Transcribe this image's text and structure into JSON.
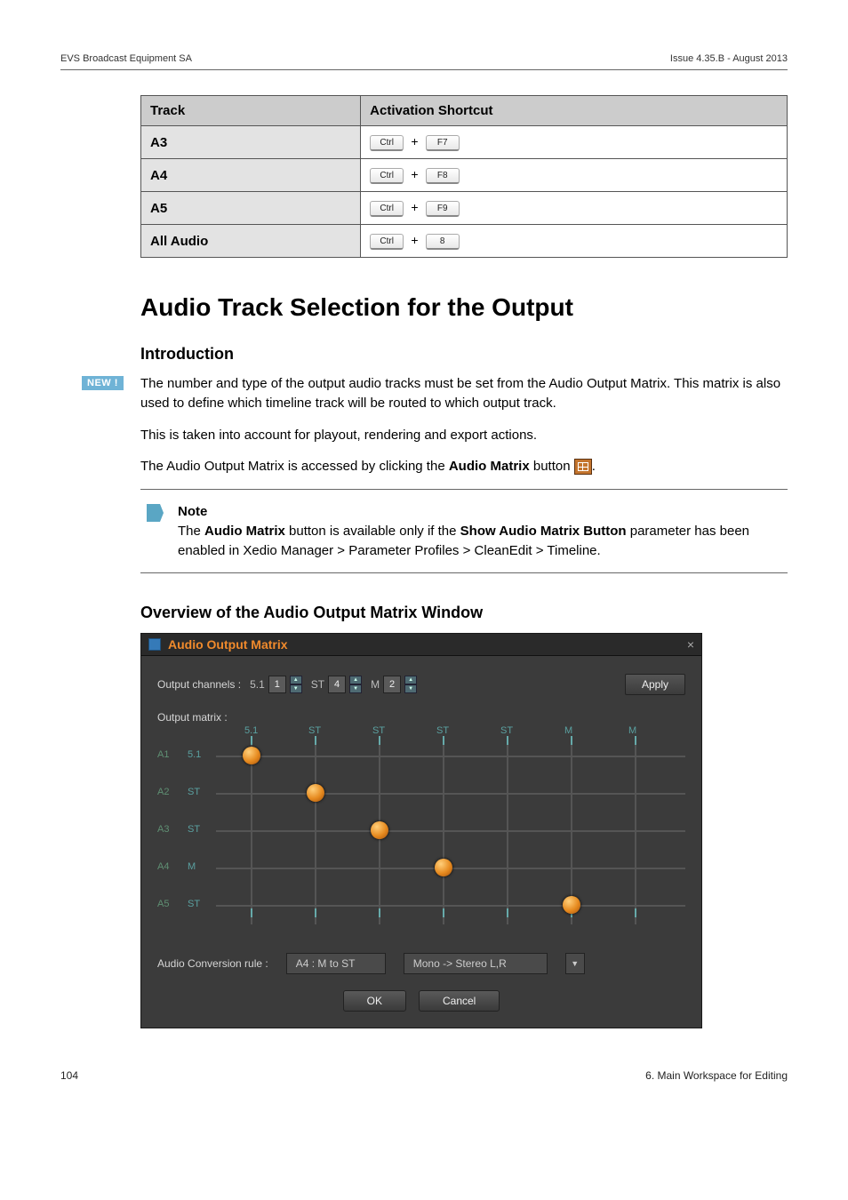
{
  "header": {
    "left": "EVS Broadcast Equipment SA",
    "right": "Issue 4.35.B - August 2013"
  },
  "table": {
    "headers": [
      "Track",
      "Activation Shortcut"
    ],
    "rows": [
      {
        "label": "A3",
        "keys": [
          "Ctrl",
          "F7"
        ]
      },
      {
        "label": "A4",
        "keys": [
          "Ctrl",
          "F8"
        ]
      },
      {
        "label": "A5",
        "keys": [
          "Ctrl",
          "F9"
        ]
      },
      {
        "label": "All Audio",
        "keys": [
          "Ctrl",
          "8"
        ]
      }
    ]
  },
  "section_title": "Audio Track Selection for the Output",
  "intro_heading": "Introduction",
  "new_badge": "NEW !",
  "intro_p1": "The number and type of the output audio tracks must be set from the Audio Output Matrix. This matrix is also used to define which timeline track will be routed to which output track.",
  "intro_p2": "This is taken into account for playout, rendering and export actions.",
  "intro_p3a": "The Audio Output Matrix is accessed by clicking the ",
  "intro_p3b": "Audio Matrix",
  "intro_p3c": " button ",
  "intro_p3d": ".",
  "note": {
    "title": "Note",
    "body_a": "The ",
    "body_b": "Audio Matrix",
    "body_c": " button is available only if the ",
    "body_d": "Show Audio Matrix Button",
    "body_e": " parameter has been enabled in Xedio Manager > Parameter Profiles > CleanEdit > Timeline."
  },
  "overview_heading": "Overview of the Audio Output Matrix Window",
  "aom": {
    "title": "Audio Output Matrix",
    "close": "×",
    "channels_label": "Output channels :",
    "channels": [
      {
        "tag": "5.1",
        "val": "1"
      },
      {
        "tag": "ST",
        "val": "4"
      },
      {
        "tag": "M",
        "val": "2"
      }
    ],
    "apply": "Apply",
    "matrix_label": "Output matrix :",
    "col_headers": [
      "5.1",
      "ST",
      "ST",
      "ST",
      "ST",
      "M",
      "M"
    ],
    "row_headers": [
      {
        "n": "A1",
        "t": "5.1"
      },
      {
        "n": "A2",
        "t": "ST"
      },
      {
        "n": "A3",
        "t": "ST"
      },
      {
        "n": "A4",
        "t": "M"
      },
      {
        "n": "A5",
        "t": "ST"
      }
    ],
    "nodes": [
      {
        "col": 0,
        "row": 0
      },
      {
        "col": 1,
        "row": 1
      },
      {
        "col": 2,
        "row": 2
      },
      {
        "col": 3,
        "row": 3
      },
      {
        "col": 5,
        "row": 4
      }
    ],
    "conv_label": "Audio Conversion rule :",
    "conv_field1": "A4 : M to ST",
    "conv_field2": "Mono -> Stereo L,R",
    "ok": "OK",
    "cancel": "Cancel"
  },
  "footer": {
    "left": "104",
    "right": "6. Main Workspace for Editing"
  }
}
